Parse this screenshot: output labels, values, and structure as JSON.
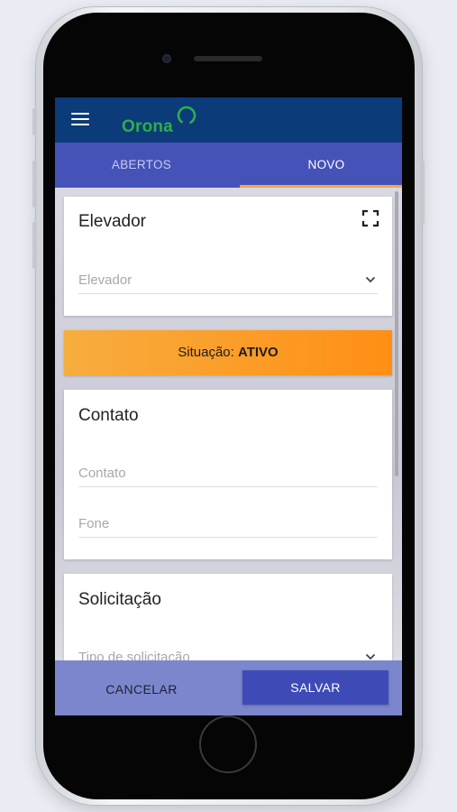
{
  "app": {
    "logo_text": "Orona",
    "colors": {
      "appbar": "#0b3b78",
      "tabs": "#4552b8",
      "accent": "#f6a44b",
      "status": "#ff9a22",
      "save": "#3e4bb7"
    }
  },
  "tabs": [
    {
      "label": "ABERTOS",
      "active": false
    },
    {
      "label": "NOVO",
      "active": true
    }
  ],
  "elevator_card": {
    "title": "Elevador",
    "field_placeholder": "Elevador",
    "scan_icon": "fullscreen-scan-icon"
  },
  "status": {
    "label": "Situação:",
    "value": "ATIVO"
  },
  "contact_card": {
    "title": "Contato",
    "contact_placeholder": "Contato",
    "phone_placeholder": "Fone"
  },
  "request_card": {
    "title": "Solicitação",
    "type_placeholder": "Tipo de solicitação"
  },
  "actions": {
    "cancel_label": "CANCELAR",
    "save_label": "SALVAR"
  }
}
